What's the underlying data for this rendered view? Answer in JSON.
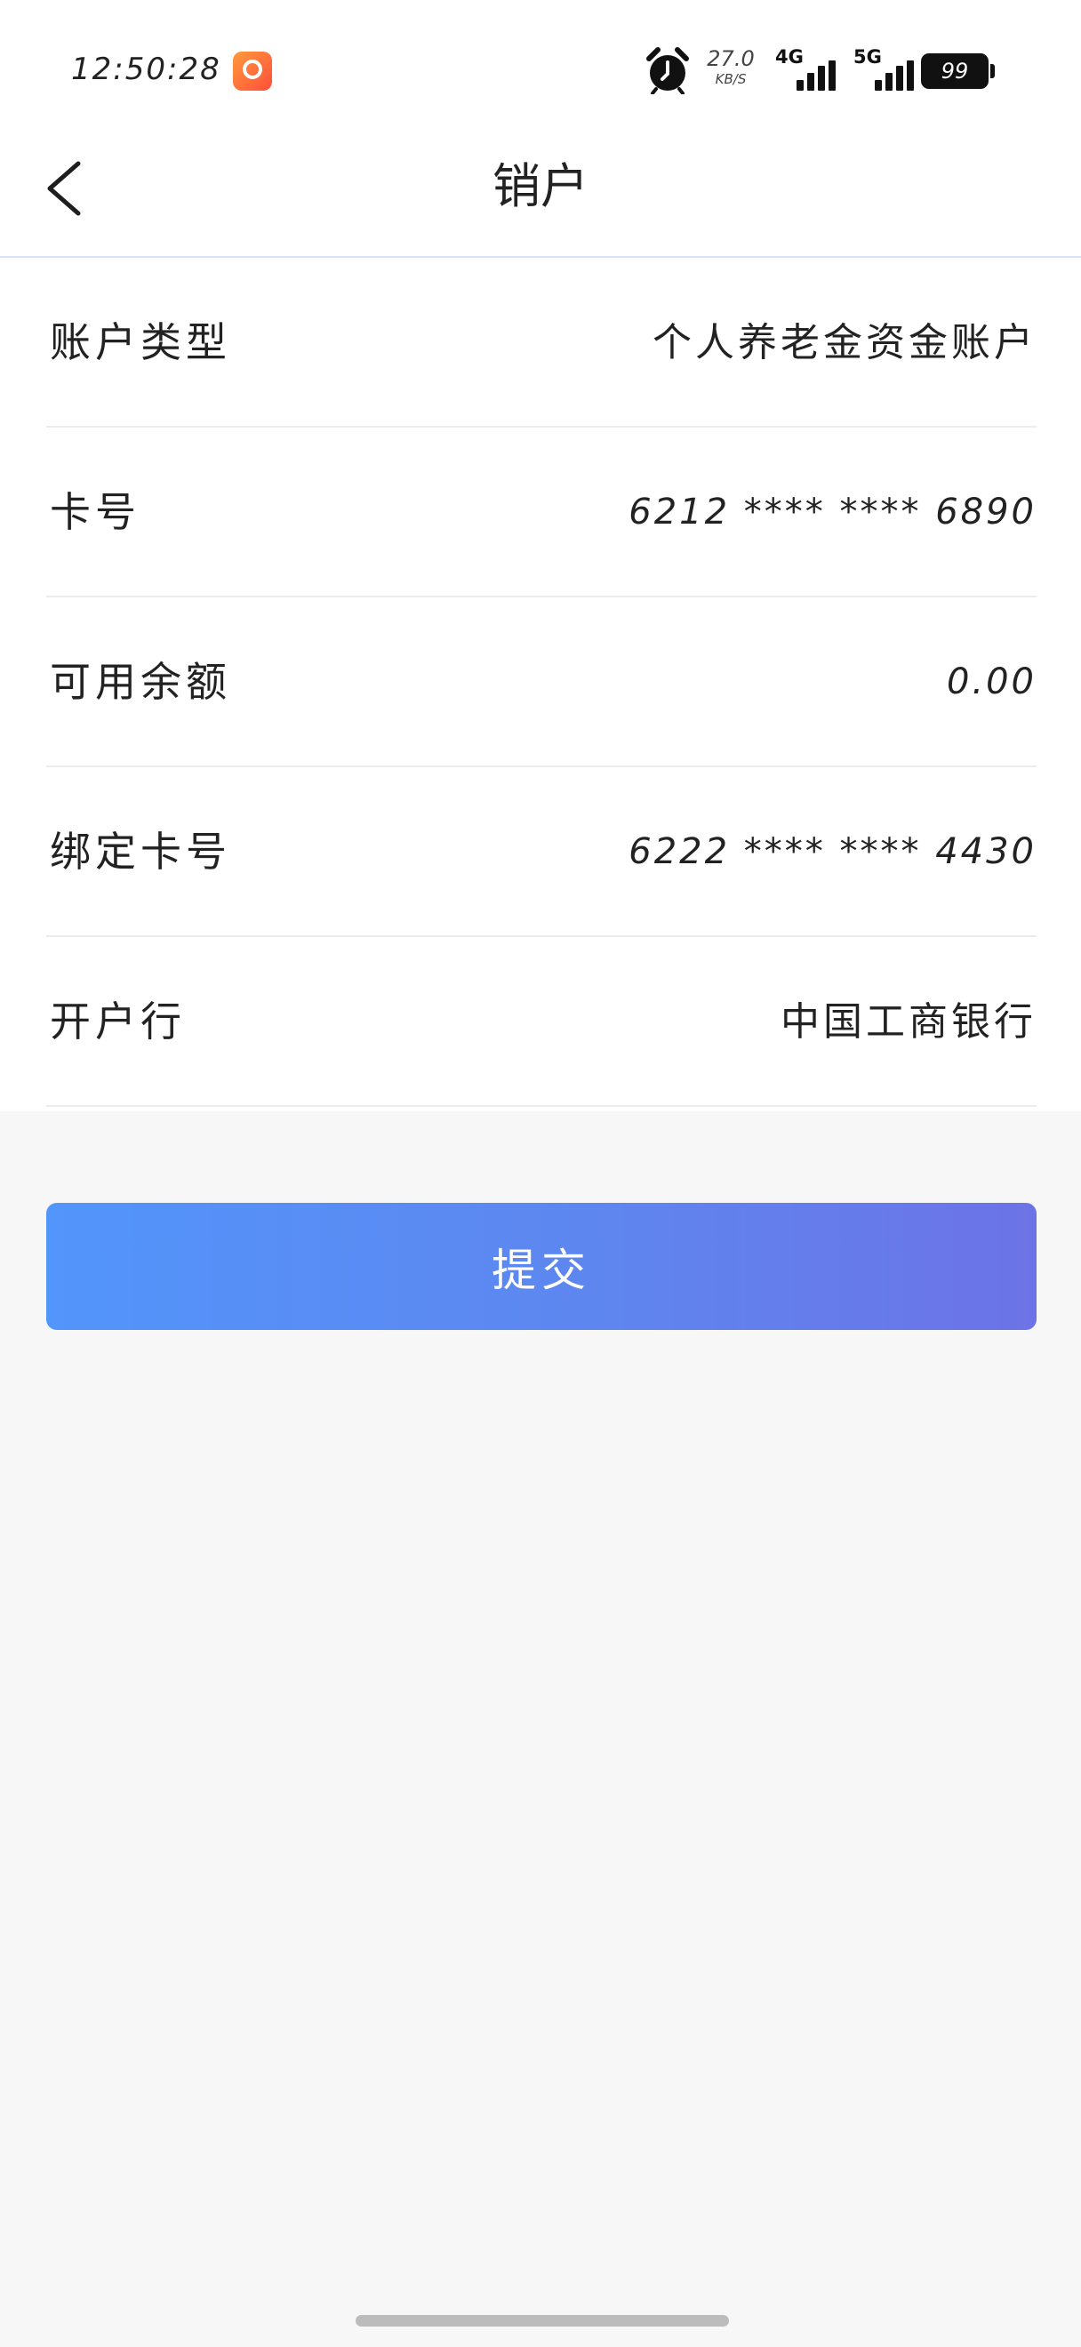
{
  "status_bar": {
    "time": "12:50:28",
    "app_icon": "video-app-icon",
    "alarm_icon": "alarm-clock-icon",
    "net_speed_value": "27.0",
    "net_speed_unit": "KB/S",
    "signal_1_label": "4G",
    "signal_2_label": "5G",
    "battery_level": "99"
  },
  "nav": {
    "back_icon": "chevron-left-icon",
    "title": "销户"
  },
  "details": {
    "rows": [
      {
        "label": "账户类型",
        "value": "个人养老金资金账户"
      },
      {
        "label": "卡号",
        "value": "6212 **** **** 6890"
      },
      {
        "label": "可用余额",
        "value": "0.00"
      },
      {
        "label": "绑定卡号",
        "value": "6222 **** **** 4430"
      },
      {
        "label": "开户行",
        "value": "中国工商银行"
      }
    ]
  },
  "actions": {
    "submit_label": "提交"
  },
  "colors": {
    "accent_start": "#5295fb",
    "accent_end": "#6c73e6",
    "page_background": "#f7f7f8"
  }
}
